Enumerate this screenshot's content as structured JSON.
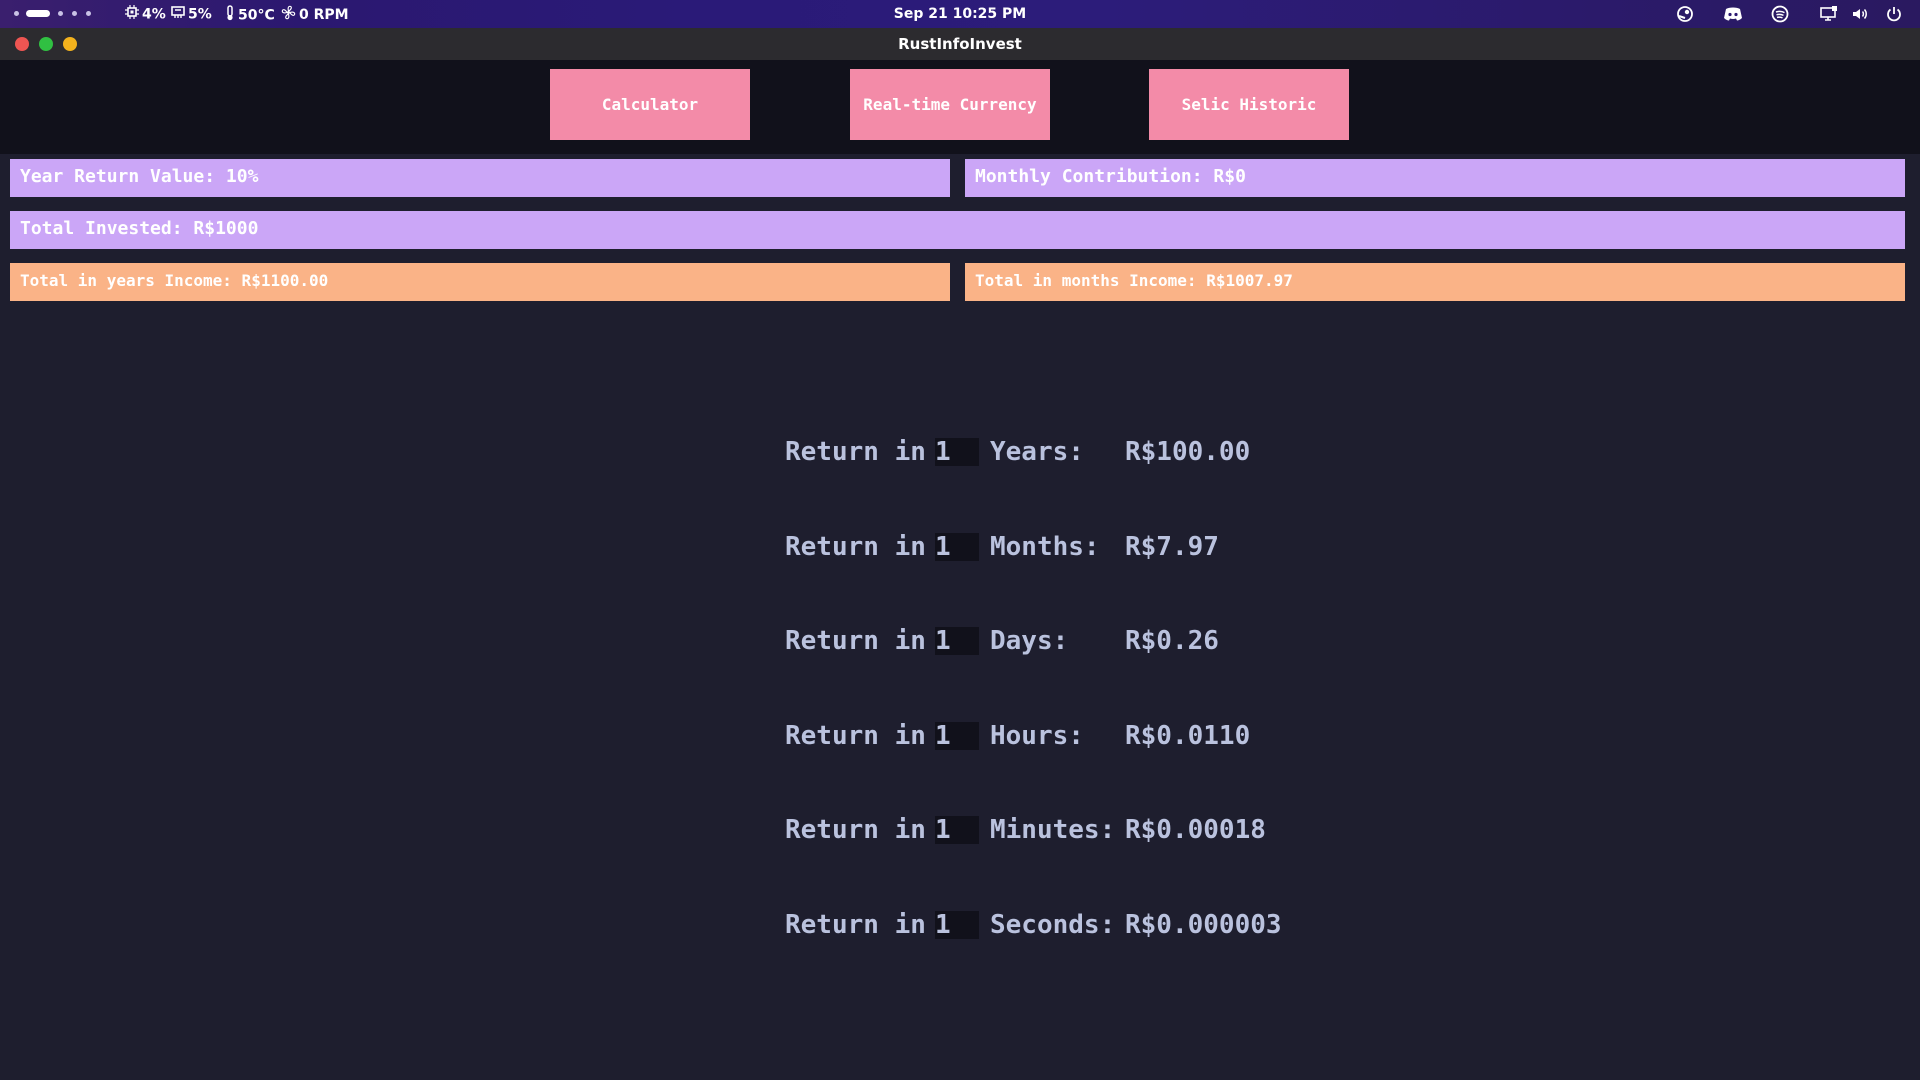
{
  "system_bar": {
    "workspaces": 6,
    "active_workspace": 2,
    "cpu": "4%",
    "memory": "5%",
    "temperature": "50°C",
    "fan": "0 RPM",
    "clock": "Sep 21  10:25 PM",
    "tray_icons": [
      "steam-icon",
      "discord-icon",
      "spotify-icon",
      "display-icon",
      "volume-icon",
      "power-icon"
    ]
  },
  "window": {
    "title": "RustInfoInvest",
    "controls": [
      "close",
      "maximize",
      "minimize"
    ],
    "control_colors": {
      "close": "#ee5552",
      "maximize": "#30c042",
      "minimize": "#f3b21d"
    }
  },
  "nav": {
    "buttons": [
      "Calculator",
      "Real-time Currency",
      "Selic Historic"
    ]
  },
  "info": {
    "year_return": "Year Return Value: 10%",
    "monthly_contribution": "Monthly Contribution: R$0",
    "total_invested": "Total Invested: R$1000",
    "total_years_income": "Total in years Income: R$1100.00",
    "total_months_income": "Total in months Income: R$1007.97"
  },
  "returns": {
    "prefix": "Return in",
    "rows": [
      {
        "amount": "1",
        "unit": "Years:",
        "value": "R$100.00"
      },
      {
        "amount": "1",
        "unit": "Months:",
        "value": "R$7.97"
      },
      {
        "amount": "1",
        "unit": "Days:",
        "value": "R$0.26"
      },
      {
        "amount": "1",
        "unit": "Hours:",
        "value": "R$0.0110"
      },
      {
        "amount": "1",
        "unit": "Minutes:",
        "value": "R$0.00018"
      },
      {
        "amount": "1",
        "unit": "Seconds:",
        "value": "R$0.000003"
      }
    ]
  },
  "colors": {
    "background": "#1e1e2e",
    "nav_background": "#11111b",
    "nav_button": "#f38ba8",
    "info_purple": "#cba6f7",
    "info_orange": "#fab387",
    "text": "#bac2de"
  }
}
